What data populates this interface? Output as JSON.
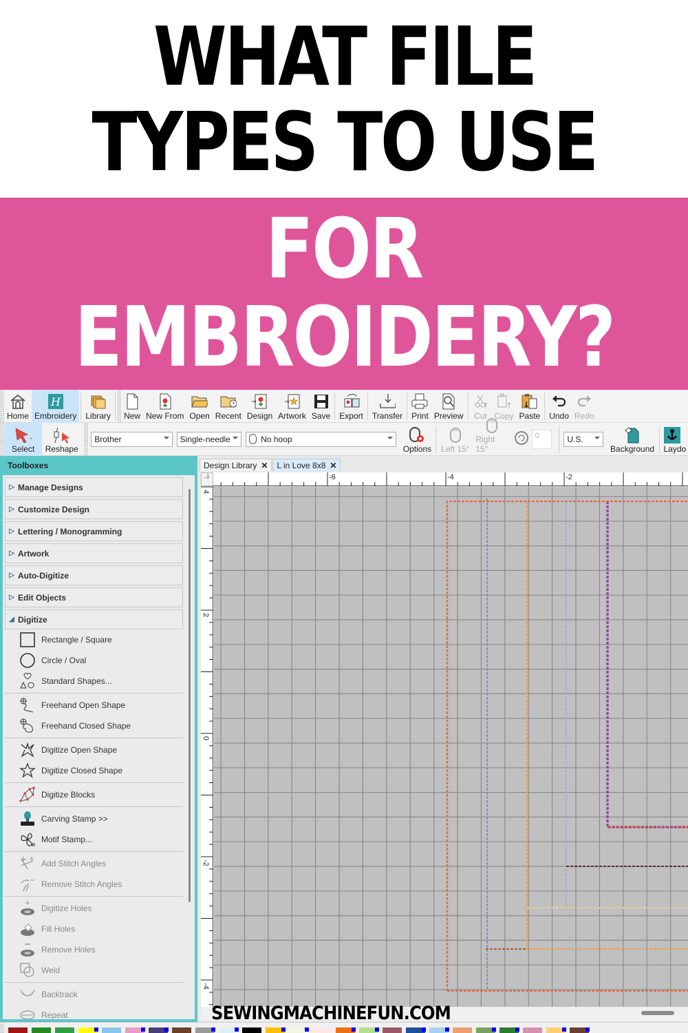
{
  "headline": {
    "line1": "WHAT FILE",
    "line2": "TYPES TO USE",
    "banner_line1": "FOR",
    "banner_line2": "EMBROIDERY?",
    "banner_color": "#df559a"
  },
  "ribbon": {
    "buttons": [
      {
        "label": "Home",
        "icon": "home-icon"
      },
      {
        "label": "Embroidery",
        "icon": "embroidery-icon",
        "active": true
      },
      {
        "label": "Library",
        "icon": "library-icon"
      },
      {
        "label": "New",
        "icon": "new-file-icon"
      },
      {
        "label": "New From",
        "icon": "new-from-icon"
      },
      {
        "label": "Open",
        "icon": "open-folder-icon"
      },
      {
        "label": "Recent",
        "icon": "recent-icon"
      },
      {
        "label": "Design",
        "icon": "design-icon"
      },
      {
        "label": "Artwork",
        "icon": "artwork-icon"
      },
      {
        "label": "Save",
        "icon": "save-icon"
      },
      {
        "label": "Export",
        "icon": "export-icon"
      },
      {
        "label": "Transfer",
        "icon": "transfer-icon"
      },
      {
        "label": "Print",
        "icon": "print-icon"
      },
      {
        "label": "Preview",
        "icon": "preview-icon"
      },
      {
        "label": "Cut",
        "icon": "cut-icon",
        "disabled": true
      },
      {
        "label": "Copy",
        "icon": "copy-icon",
        "disabled": true
      },
      {
        "label": "Paste",
        "icon": "paste-icon"
      },
      {
        "label": "Undo",
        "icon": "undo-icon"
      },
      {
        "label": "Redo",
        "icon": "redo-icon",
        "disabled": true
      }
    ]
  },
  "toolbar2": {
    "select_label": "Select",
    "reshape_label": "Reshape",
    "machine_brand": "Brother",
    "needle_type": "Single-needle",
    "hoop": "No hoop",
    "options_label": "Options",
    "left15_label": "Left 15°",
    "right15_label": "Right 15°",
    "rotation_value": "0",
    "units": "U.S.",
    "background_label": "Background",
    "laydown_label": "Laydo"
  },
  "sidebar": {
    "title": "Toolboxes",
    "sections": [
      {
        "label": "Manage Designs",
        "expanded": false
      },
      {
        "label": "Customize Design",
        "expanded": false
      },
      {
        "label": "Lettering / Monogramming",
        "expanded": false
      },
      {
        "label": "Artwork",
        "expanded": false
      },
      {
        "label": "Auto-Digitize",
        "expanded": false
      },
      {
        "label": "Edit Objects",
        "expanded": false
      },
      {
        "label": "Digitize",
        "expanded": true
      }
    ],
    "tools": [
      {
        "label": "Rectangle / Square",
        "group": 1
      },
      {
        "label": "Circle / Oval",
        "group": 1
      },
      {
        "label": "Standard Shapes...",
        "group": 1
      },
      {
        "label": "Freehand Open Shape",
        "group": 2
      },
      {
        "label": "Freehand Closed Shape",
        "group": 2
      },
      {
        "label": "Digitize Open Shape",
        "group": 3
      },
      {
        "label": "Digitize Closed Shape",
        "group": 3
      },
      {
        "label": "Digitize Blocks",
        "group": 4
      },
      {
        "label": "Carving Stamp >>",
        "group": 5
      },
      {
        "label": "Motif Stamp...",
        "group": 5
      },
      {
        "label": "Add Stitch Angles",
        "group": 6,
        "disabled": true
      },
      {
        "label": "Remove Stitch Angles",
        "group": 6,
        "disabled": true
      },
      {
        "label": "Digitize Holes",
        "group": 7,
        "disabled": true
      },
      {
        "label": "Fill Holes",
        "group": 7,
        "disabled": true
      },
      {
        "label": "Remove Holes",
        "group": 7,
        "disabled": true
      },
      {
        "label": "Weld",
        "group": 7,
        "disabled": true
      },
      {
        "label": "Backtrack",
        "group": 8,
        "disabled": true
      },
      {
        "label": "Repeat",
        "group": 8,
        "disabled": true
      }
    ]
  },
  "document": {
    "tabs": [
      {
        "label": "Design Library",
        "active": false
      },
      {
        "label": "L in Love 8x8",
        "active": true
      }
    ],
    "ruler_top_labels": [
      "-6",
      "-4",
      "-2"
    ],
    "ruler_left_labels": [
      "4",
      "2",
      "0",
      "-2",
      "-4"
    ]
  },
  "colorbar": {
    "swatches": [
      "#a01818",
      "#228b22",
      "#2ea043",
      "#ffff00",
      "#8cc4f0",
      "#e89ac8",
      "#4a3c7a",
      "#6b3f2a",
      "#9a9a9a",
      "#ddeeff",
      "#000000",
      "#ffc000",
      "#f4f4e0",
      "#fde8e8",
      "#ee7010",
      "#b4e08c",
      "#9a5a6a",
      "#1f4e9a",
      "#a8d0f0",
      "#eaa070",
      "#7aa060",
      "#2e7a2e",
      "#d890b0",
      "#ffd070",
      "#6b4030"
    ]
  },
  "watermark": "SEWINGMACHINEFUN.COM"
}
